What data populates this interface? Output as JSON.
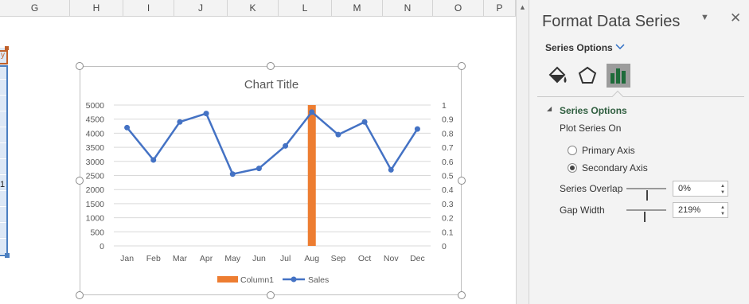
{
  "sheet": {
    "columns": [
      "G",
      "H",
      "I",
      "J",
      "K",
      "L",
      "M",
      "N",
      "O",
      "P"
    ],
    "left_partial_value": "1",
    "left_partial_tag": "y"
  },
  "chart": {
    "title": "Chart Title"
  },
  "chart_data": {
    "type": "bar",
    "title": "Chart Title",
    "categories": [
      "Jan",
      "Feb",
      "Mar",
      "Apr",
      "May",
      "Jun",
      "Jul",
      "Aug",
      "Sep",
      "Oct",
      "Nov",
      "Dec"
    ],
    "primary_axis": {
      "ylim": [
        0,
        5000
      ],
      "ticks": [
        "0",
        "500",
        "1000",
        "1500",
        "2000",
        "2500",
        "3000",
        "3500",
        "4000",
        "4500",
        "5000"
      ]
    },
    "secondary_axis": {
      "ylim": [
        0,
        1
      ],
      "ticks": [
        "0",
        "0.1",
        "0.2",
        "0.3",
        "0.4",
        "0.5",
        "0.6",
        "0.7",
        "0.8",
        "0.9",
        "1"
      ]
    },
    "series": [
      {
        "name": "Column1",
        "type": "bar",
        "axis": "secondary",
        "color": "#ED7D31",
        "values": [
          0,
          0,
          0,
          0,
          0,
          0,
          0,
          1,
          0,
          0,
          0,
          0
        ]
      },
      {
        "name": "Sales",
        "type": "line",
        "axis": "primary",
        "color": "#4472C4",
        "values": [
          4200,
          3050,
          4400,
          4700,
          2550,
          2750,
          3550,
          4750,
          3950,
          4400,
          2700,
          4150
        ]
      }
    ],
    "grid": true,
    "legend_position": "bottom"
  },
  "pane": {
    "title": "Format Data Series",
    "options_dropdown": "Series Options",
    "section_title": "Series Options",
    "plot_series_on": "Plot Series On",
    "primary_axis": "Primary Axis",
    "secondary_axis": "Secondary Axis",
    "secondary_selected": true,
    "series_overlap_label": "Series Overlap",
    "series_overlap_value": "0%",
    "gap_width_label": "Gap Width",
    "gap_width_value": "219%",
    "series_overlap_fraction": 0.5,
    "gap_width_fraction": 0.44
  },
  "icons": {
    "fill": "paint-bucket-icon",
    "effects": "pentagon-icon",
    "series_options": "bar-chart-icon",
    "close": "close-icon",
    "menu": "chevron-down-icon"
  }
}
